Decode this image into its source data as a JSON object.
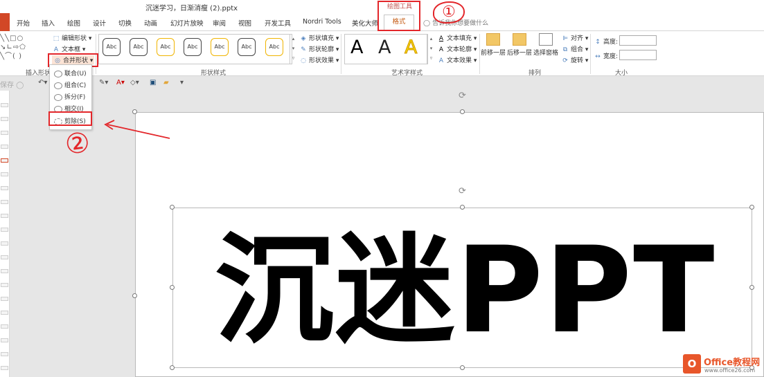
{
  "window": {
    "file_title": "沉迷学习，日渐消瘦 (2).pptx",
    "context_label": "绘图工具"
  },
  "tabs": [
    {
      "label": "开始"
    },
    {
      "label": "插入"
    },
    {
      "label": "绘图"
    },
    {
      "label": "设计"
    },
    {
      "label": "切换"
    },
    {
      "label": "动画"
    },
    {
      "label": "幻灯片放映"
    },
    {
      "label": "审阅"
    },
    {
      "label": "视图"
    },
    {
      "label": "开发工具"
    },
    {
      "label": "Nordri Tools"
    },
    {
      "label": "美化大师"
    }
  ],
  "active_tab": "格式",
  "tell_me": "告诉我你想要做什么",
  "ribbon": {
    "insert_shapes": {
      "label": "插入形状",
      "edit_shape": "编辑形状",
      "text_box": "文本框",
      "merge_shapes": "合并形状"
    },
    "shape_styles": {
      "label": "形状样式",
      "style_samples": [
        "Abc",
        "Abc",
        "Abc",
        "Abc",
        "Abc",
        "Abc"
      ],
      "fill": "形状填充",
      "outline": "形状轮廓",
      "effects": "形状效果"
    },
    "wordart": {
      "label": "艺术字样式",
      "samples": [
        "A",
        "A",
        "A"
      ],
      "text_fill": "文本填充",
      "text_outline": "文本轮廓",
      "text_effects": "文本效果"
    },
    "arrange": {
      "label": "排列",
      "bring_forward": "前移一层",
      "send_backward": "后移一层",
      "selection_pane": "选择窗格",
      "align": "对齐",
      "group": "组合",
      "rotate": "旋转"
    },
    "size": {
      "label": "大小",
      "height": "高度:",
      "width": "宽度:"
    }
  },
  "qat": {
    "autosave": "保存"
  },
  "merge_menu": {
    "items": [
      "联合(U)",
      "组合(C)",
      "拆分(F)",
      "相交(I)",
      "剪除(S)"
    ]
  },
  "annotations": {
    "one": "①",
    "two": "②"
  },
  "slide": {
    "text": "沉迷PPT"
  },
  "watermark": {
    "title": "Office教程网",
    "url": "www.office26.com",
    "logo": "O"
  },
  "colors": {
    "accent_orange": "#c55a11",
    "file_tab": "#d24726",
    "annotation_red": "#e3262a"
  }
}
